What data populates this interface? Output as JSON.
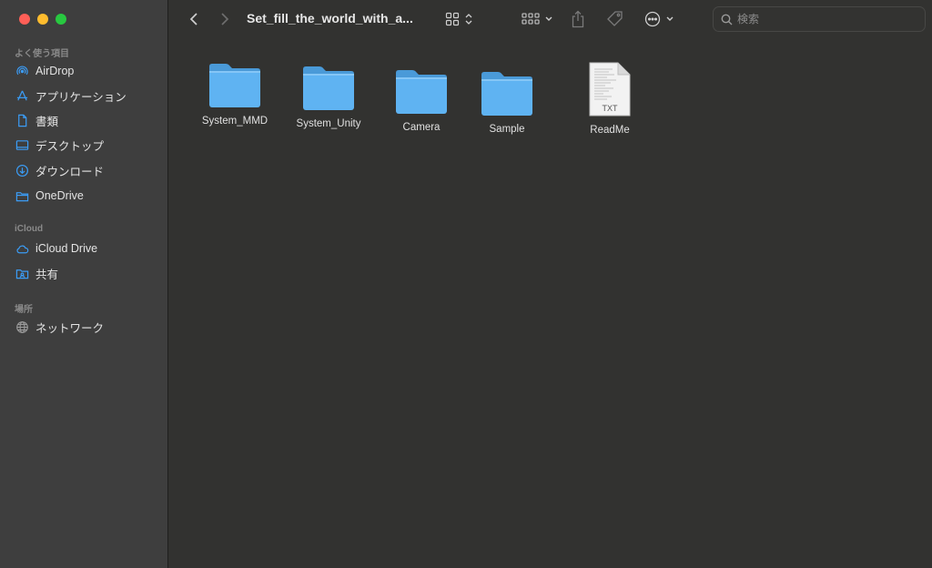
{
  "window": {
    "title": "Set_fill_the_world_with_a..."
  },
  "search": {
    "placeholder": "検索"
  },
  "sidebar": {
    "favorites_header": "よく使う項目",
    "favorites": [
      {
        "label": "AirDrop",
        "icon": "airdrop-icon"
      },
      {
        "label": "アプリケーション",
        "icon": "applications-icon"
      },
      {
        "label": "書類",
        "icon": "document-icon"
      },
      {
        "label": "デスクトップ",
        "icon": "desktop-icon"
      },
      {
        "label": "ダウンロード",
        "icon": "download-icon"
      },
      {
        "label": "OneDrive",
        "icon": "folder-icon"
      }
    ],
    "icloud_header": "iCloud",
    "icloud": [
      {
        "label": "iCloud Drive",
        "icon": "cloud-icon"
      },
      {
        "label": "共有",
        "icon": "shared-folder-icon"
      }
    ],
    "locations_header": "場所",
    "locations": [
      {
        "label": "ネットワーク",
        "icon": "network-icon"
      }
    ]
  },
  "files": [
    {
      "name": "System_MMD",
      "kind": "folder"
    },
    {
      "name": "System_Unity",
      "kind": "folder"
    },
    {
      "name": "Camera",
      "kind": "folder"
    },
    {
      "name": "Sample",
      "kind": "folder"
    },
    {
      "name": "ReadMe",
      "kind": "text-file",
      "badge": "TXT"
    }
  ],
  "colors": {
    "accent": "#3b9cf5",
    "folder": "#5fb3f2",
    "sidebar_bg": "#3e3e3e",
    "content_bg": "#323230"
  }
}
